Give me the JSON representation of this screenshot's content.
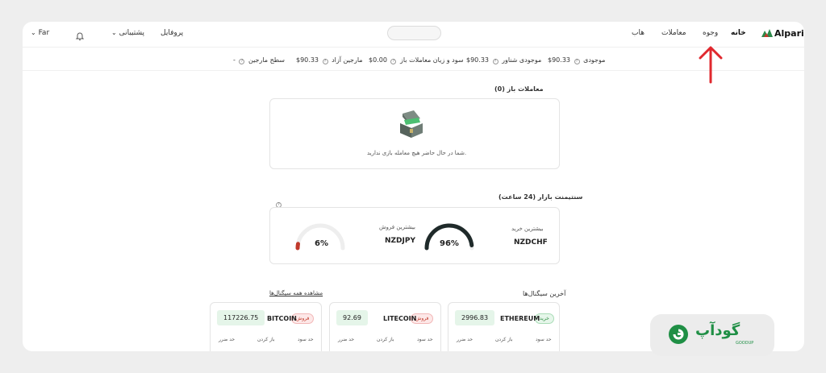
{
  "header": {
    "logo_text": "Alpari",
    "nav": [
      "خانه",
      "وجوه",
      "معاملات",
      "هاب"
    ],
    "right": {
      "profile": "پروفایل",
      "support": "پشتیبانی",
      "language": "Far"
    }
  },
  "status": [
    {
      "label": "موجودی",
      "value": "$90.33"
    },
    {
      "label": "موجودی شناور",
      "value": "$90.33"
    },
    {
      "label": "سود و زیان معاملات باز",
      "value": "$0.00"
    },
    {
      "label": "مارجین آزاد",
      "value": "$90.33"
    },
    {
      "label": "سطح مارجین",
      "value": "-"
    }
  ],
  "open_trades": {
    "title": "معاملات باز (0)",
    "empty_message": "شما در حال حاضر هیچ معامله بازی ندارید."
  },
  "sentiment": {
    "title": "سنتیمنت بازار (24 ساعت)",
    "most_buy_label": "بیشترین خرید",
    "most_buy_symbol": "NZDCHF",
    "most_buy_percent": "96%",
    "most_buy_value": 96,
    "most_sell_label": "بیشترین فروش",
    "most_sell_symbol": "NZDJPY",
    "most_sell_percent": "6%",
    "most_sell_value": 6
  },
  "signals": {
    "title": "آخرین سیگنال‌ها",
    "view_all": "مشاهده همه سیگنال‌ها",
    "cards": [
      {
        "symbol": "ETHEREUM",
        "badge": "خرید",
        "price": "2996.83",
        "col1": "حد سود",
        "col2": "باز کردن",
        "col3": "حد ضرر"
      },
      {
        "symbol": "LITECOIN",
        "badge": "فروش",
        "price": "92.69",
        "col1": "حد سود",
        "col2": "باز کردن",
        "col3": "حد ضرر"
      },
      {
        "symbol": "BITCOIN",
        "badge": "فروش",
        "price": "117226.75",
        "col1": "حد سود",
        "col2": "باز کردن",
        "col3": "حد ضرر"
      }
    ]
  },
  "watermark": {
    "text": "گودآپ",
    "sub": "GOODUP"
  },
  "colors": {
    "accent_green": "#1f8f45",
    "arrow_red": "#e0282e",
    "gauge_dark": "#1f2a2a",
    "gauge_light": "#eeeeee"
  },
  "icons": [
    "bell-icon",
    "chevron-down-icon",
    "help-circle-icon",
    "treasure-chest-icon",
    "up-arrow-annotation"
  ]
}
